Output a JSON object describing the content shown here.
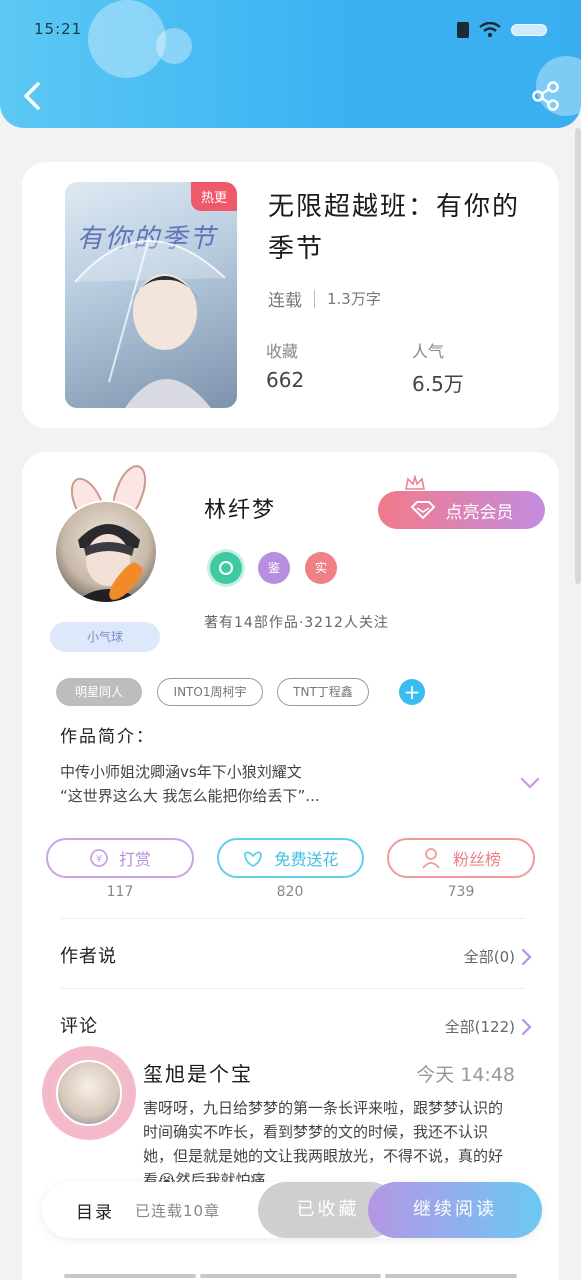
{
  "status_bar": {
    "time": "15:21"
  },
  "book": {
    "hot_badge": "热更",
    "cover_text": "有你的季节",
    "title": "无限超越班：有你的季节",
    "status": "连载",
    "word_count": "1.3万字",
    "favorites_label": "收藏",
    "favorites_value": "662",
    "popularity_label": "人气",
    "popularity_value": "6.5万"
  },
  "author": {
    "name": "林纤梦",
    "member_button": "点亮会员",
    "badges": [
      "",
      "鉴",
      "实"
    ],
    "tag": "小气球",
    "stats": "著有14部作品·3212人关注",
    "tags": [
      "明星同人",
      "INTO1周柯宇",
      "TNT丁程鑫"
    ]
  },
  "intro": {
    "title": "作品简介：",
    "line1": "中传小师姐沈卿涵vs年下小狼刘耀文",
    "line2": "“这世界这么大 我怎么能把你给丢下”..."
  },
  "actions": [
    {
      "label": "打赏",
      "count": "117",
      "color": "#b88fe0"
    },
    {
      "label": "免费送花",
      "count": "820",
      "color": "#4fc6e6"
    },
    {
      "label": "粉丝榜",
      "count": "739",
      "color": "#ef7f86"
    }
  ],
  "author_says": {
    "title": "作者说",
    "link": "全部(0)"
  },
  "comments": {
    "title": "评论",
    "link": "全部(122)",
    "first": {
      "name": "玺旭是个宝",
      "time": "今天 14:48",
      "text": "害呀呀，九日给梦梦的第一条长评来啦，跟梦梦认识的时间确实不咋长，看到梦梦的文的时候，我还不认识她，但是就是她的文让我两眼放光，不得不说，真的好看😭然后我就怕痛"
    }
  },
  "bottom": {
    "toc_label": "目录",
    "toc_count": "已连载10章",
    "fav_button": "已收藏",
    "read_button": "继续阅读"
  }
}
